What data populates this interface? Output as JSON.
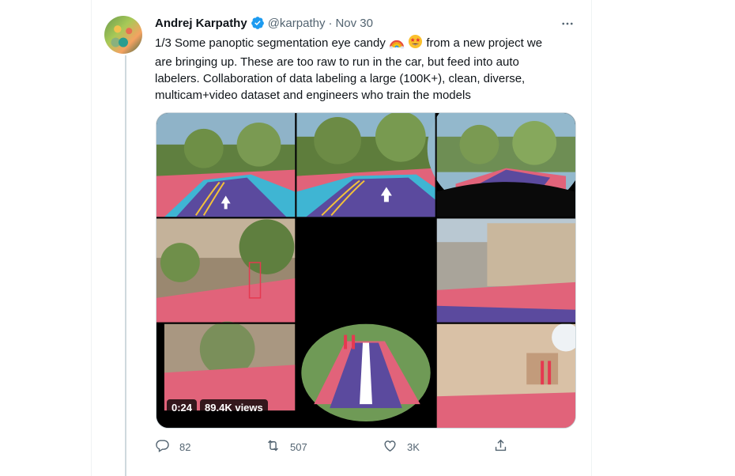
{
  "tweet": {
    "author_name": "Andrej Karpathy",
    "handle": "@karpathy",
    "separator": "·",
    "date": "Nov 30",
    "more_icon": "more-horizontal-icon",
    "verified_icon": "verified-badge-icon",
    "text_lines": [
      "1/3 Some panoptic segmentation eye candy",
      "from a new project we",
      "are bringing up. These are too raw to run in the car, but feed into auto",
      "labelers. Collaboration of data labeling a large (100K+), clean, diverse,",
      "multicam+video dataset and engineers who train the models"
    ],
    "emojis": [
      "rainbow-emoji",
      "star-struck-emoji"
    ]
  },
  "media": {
    "video_time": "0:24",
    "views": "89.4K views",
    "grid_cells": 9
  },
  "actions": {
    "reply": {
      "icon": "reply-icon",
      "count": "82"
    },
    "retweet": {
      "icon": "retweet-icon",
      "count": "507"
    },
    "like": {
      "icon": "heart-icon",
      "count": "3K"
    },
    "share": {
      "icon": "share-icon"
    }
  },
  "colors": {
    "accent": "#1d9bf0",
    "secondary_text": "#536471",
    "segmentation_road": "#5b4a9e",
    "segmentation_sidewalk": "#e1637a",
    "segmentation_lane": "#3fb5d3"
  }
}
